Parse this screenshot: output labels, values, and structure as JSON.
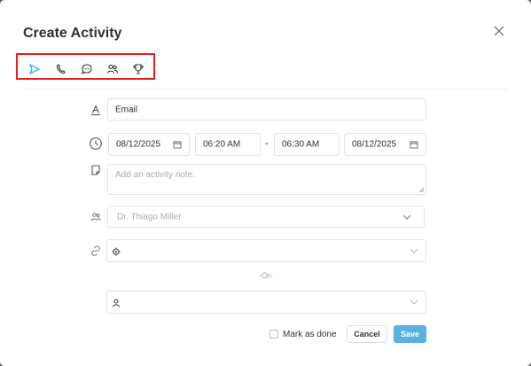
{
  "dialog": {
    "title": "Create Activity"
  },
  "tabs": [
    {
      "icon": "send-icon",
      "color": "#2aa0e0"
    },
    {
      "icon": "phone-icon",
      "color": "#333333"
    },
    {
      "icon": "chat-bubble-icon",
      "color": "#333333"
    },
    {
      "icon": "meeting-users-icon",
      "color": "#333333"
    },
    {
      "icon": "trophy-icon",
      "color": "#333333"
    }
  ],
  "form": {
    "subject_value": "Email",
    "start_date": "08/12/2025",
    "start_time": "06:20 AM",
    "range_separator": "-",
    "end_time": "06:30 AM",
    "end_date": "08/12/2025",
    "note_placeholder": "Add an activity note.",
    "owner_value": "Dr. Thiago Miller",
    "or_label": "-Or-",
    "mark_done_label": "Mark as done",
    "cancel_label": "Cancel",
    "save_label": "Save"
  },
  "colors": {
    "accent": "#5ab0e0",
    "highlight_box": "#e02020"
  }
}
